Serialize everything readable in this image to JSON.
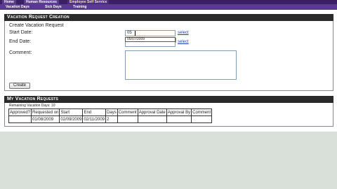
{
  "top_nav": {
    "tabs": [
      {
        "label": "Home"
      },
      {
        "label": "Human Resources"
      },
      {
        "label": "Employee Self Service"
      }
    ]
  },
  "sub_nav": {
    "items": [
      {
        "label": "Vacation Days"
      },
      {
        "label": "Sick Days"
      },
      {
        "label": "Training"
      }
    ]
  },
  "create_section": {
    "header": "Vacation Request Creation",
    "subtitle": "Create Vacation Request",
    "start_date_label": "Start Date:",
    "start_date_value": "05",
    "start_date_suggestion": "05/07/2009",
    "end_date_label": "End Date:",
    "comment_label": "Comment:",
    "select_link": "select",
    "create_button": "Create"
  },
  "requests_section": {
    "header": "My Vacation Requests",
    "remaining": "Remaining Vacation Days: 10",
    "columns": [
      "Approved?",
      "Requested on",
      "Start",
      "End",
      "Days",
      "Comment",
      "Approval Date",
      "Approval By",
      "Comment"
    ],
    "rows": [
      [
        "",
        "01/08/2009",
        "02/09/2009",
        "02/11/2009",
        "2",
        "",
        "",
        "",
        ""
      ]
    ]
  },
  "colors": {
    "nav_purple": "#3a1f62",
    "header_dark": "#2a2a2a",
    "background": "#d9dfd9"
  }
}
